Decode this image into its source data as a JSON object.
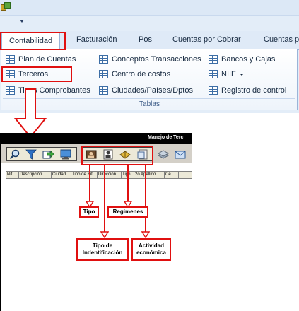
{
  "ribbon": {
    "tabs": [
      {
        "label": "Contabilidad",
        "active": true
      },
      {
        "label": "Facturación"
      },
      {
        "label": "Pos"
      },
      {
        "label": "Cuentas por Cobrar"
      },
      {
        "label": "Cuentas p"
      }
    ],
    "group_label": "Tablas",
    "items": [
      {
        "label": "Plan de Cuentas",
        "icon": "table-icon"
      },
      {
        "label": "Terceros",
        "icon": "table-icon"
      },
      {
        "label": "Tipos Comprobantes",
        "icon": "table-icon"
      },
      {
        "label": "Conceptos Transacciones",
        "icon": "table-icon"
      },
      {
        "label": "Centro de costos",
        "icon": "table-icon"
      },
      {
        "label": "Ciudades/Países/Dptos",
        "icon": "table-icon"
      },
      {
        "label": "Bancos y Cajas",
        "icon": "table-icon"
      },
      {
        "label": "NIIF",
        "icon": "table-icon"
      },
      {
        "label": "Registro de control",
        "icon": "table-icon"
      }
    ]
  },
  "window": {
    "title": "Manejo de Terc",
    "toolbar_left": [
      "search-icon",
      "filter-icon",
      "export-icon",
      "monitor-icon"
    ],
    "toolbar_right": [
      "id-card-icon",
      "person-card-icon",
      "book-icon",
      "document-icon",
      "layers-icon",
      "mail-icon"
    ],
    "columns": [
      "Nit",
      "Descripción",
      "Ciudad",
      "Tipo de Nit",
      "Dirección",
      "Tipo",
      "2o Apellido",
      "Ce"
    ]
  },
  "callouts": {
    "tipo": "Tipo",
    "regimenes": "Regimenes",
    "tipo_identificacion_line1": "Tipo de",
    "tipo_identificacion_line2": "Indentificación",
    "actividad_line1": "Actividad",
    "actividad_line2": "económica"
  },
  "colors": {
    "highlight": "#e01010",
    "ribbon_bg": "#e3edf8",
    "ribbon_text": "#15283f",
    "window_title_bg": "#000000"
  }
}
